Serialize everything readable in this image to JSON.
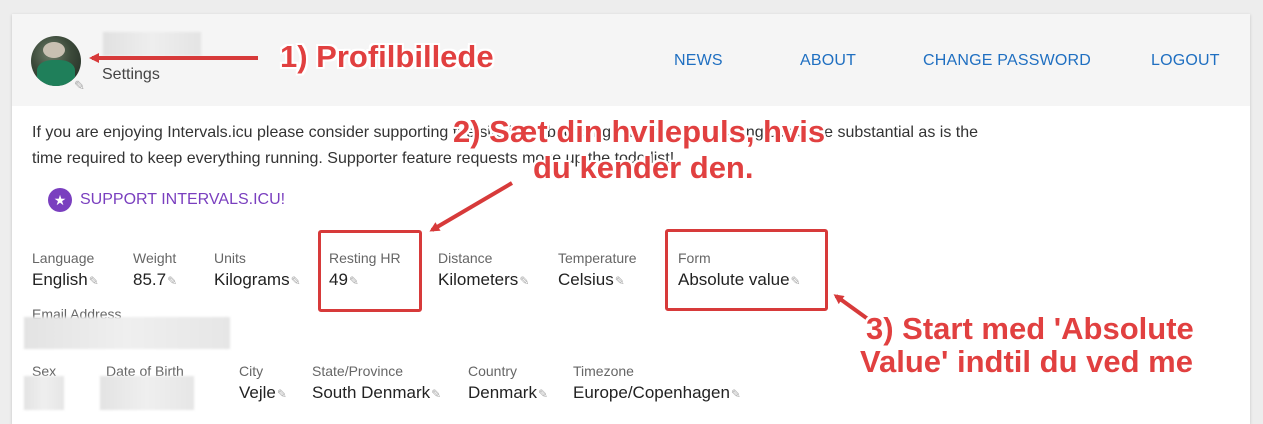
{
  "header": {
    "settings_label": "Settings",
    "nav": [
      {
        "label": "NEWS"
      },
      {
        "label": "ABOUT"
      },
      {
        "label": "CHANGE PASSWORD"
      },
      {
        "label": "LOGOUT"
      }
    ]
  },
  "intro": {
    "line1": "If you are enjoying Intervals.icu please consider supporting the site by subscribing. The monthly hosting costs are substantial as is the",
    "line2": "time required to keep everything running. Supporter feature requests move up the todo list!"
  },
  "support_button": {
    "label": "SUPPORT INTERVALS.ICU!",
    "icon": "star-icon"
  },
  "profile_row1": [
    {
      "label": "Language",
      "value": "English"
    },
    {
      "label": "Weight",
      "value": "85.7"
    },
    {
      "label": "Units",
      "value": "Kilograms"
    },
    {
      "label": "Resting HR",
      "value": "49"
    },
    {
      "label": "Distance",
      "value": "Kilometers"
    },
    {
      "label": "Temperature",
      "value": "Celsius"
    },
    {
      "label": "Form",
      "value": "Absolute value"
    }
  ],
  "email": {
    "label": "Email Address"
  },
  "profile_row2": [
    {
      "label": "Sex"
    },
    {
      "label": "Date of Birth"
    },
    {
      "label": "City",
      "value": "Vejle"
    },
    {
      "label": "State/Province",
      "value": "South Denmark"
    },
    {
      "label": "Country",
      "value": "Denmark"
    },
    {
      "label": "Timezone",
      "value": "Europe/Copenhagen"
    }
  ],
  "annotations": {
    "a1": "1) Profilbillede",
    "a2_line1": "2) Sæt din hvilepuls, hvis",
    "a2_line2": "du kender den.",
    "a3_line1": "3) Start med 'Absolute",
    "a3_line2": "Value' indtil du ved me"
  },
  "colors": {
    "link": "#1f6fc1",
    "support": "#7a3fbf",
    "annotation": "#e14040"
  }
}
